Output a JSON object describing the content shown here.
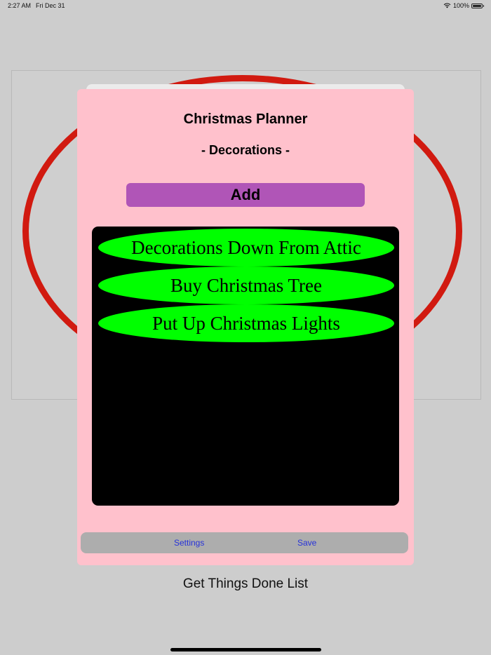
{
  "status_bar": {
    "time": "2:27 AM",
    "date": "Fri Dec 31",
    "battery": "100%",
    "icons": [
      "wifi-icon",
      "battery-icon"
    ]
  },
  "modal": {
    "title": "Christmas Planner",
    "section": "- Decorations -",
    "add_label": "Add",
    "items": [
      {
        "label": "Decorations Down From Attic"
      },
      {
        "label": "Buy Christmas Tree"
      },
      {
        "label": "Put Up Christmas Lights"
      }
    ],
    "bottom_bar": {
      "settings_label": "Settings",
      "save_label": "Save"
    }
  },
  "footer": {
    "title": "Get Things Done List"
  },
  "colors": {
    "background": "#cdcdcd",
    "modal_background": "#ffc1cc",
    "ellipse_red": "#d11a10",
    "add_button": "#b055b7",
    "list_background": "#000000",
    "item_green": "#00ff00",
    "bottom_bar": "#adadad",
    "link_blue": "#2632d9"
  }
}
